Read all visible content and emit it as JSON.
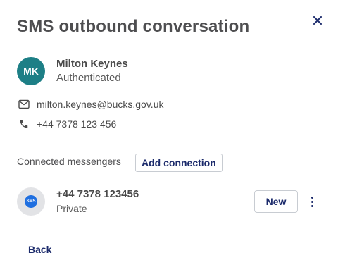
{
  "dialog": {
    "title": "SMS outbound conversation",
    "close_icon": "close-icon"
  },
  "contact": {
    "initials": "MK",
    "avatar_color": "#1d7f86",
    "name": "Milton Keynes",
    "status": "Authenticated",
    "email": "milton.keynes@bucks.gov.uk",
    "email_icon": "envelope-icon",
    "phone": "+44 7378 123 456",
    "phone_icon": "phone-icon"
  },
  "messengers": {
    "label": "Connected messengers",
    "add_button": "Add connection",
    "items": [
      {
        "icon": "sms-icon",
        "badge_text": "SMS",
        "number": "+44 7378 123456",
        "type": "Private",
        "action_button": "New",
        "menu_icon": "more-vertical-icon"
      }
    ]
  },
  "footer": {
    "back_label": "Back"
  },
  "colors": {
    "accent": "#1b2a6b",
    "sms_badge": "#1f6fe0"
  }
}
